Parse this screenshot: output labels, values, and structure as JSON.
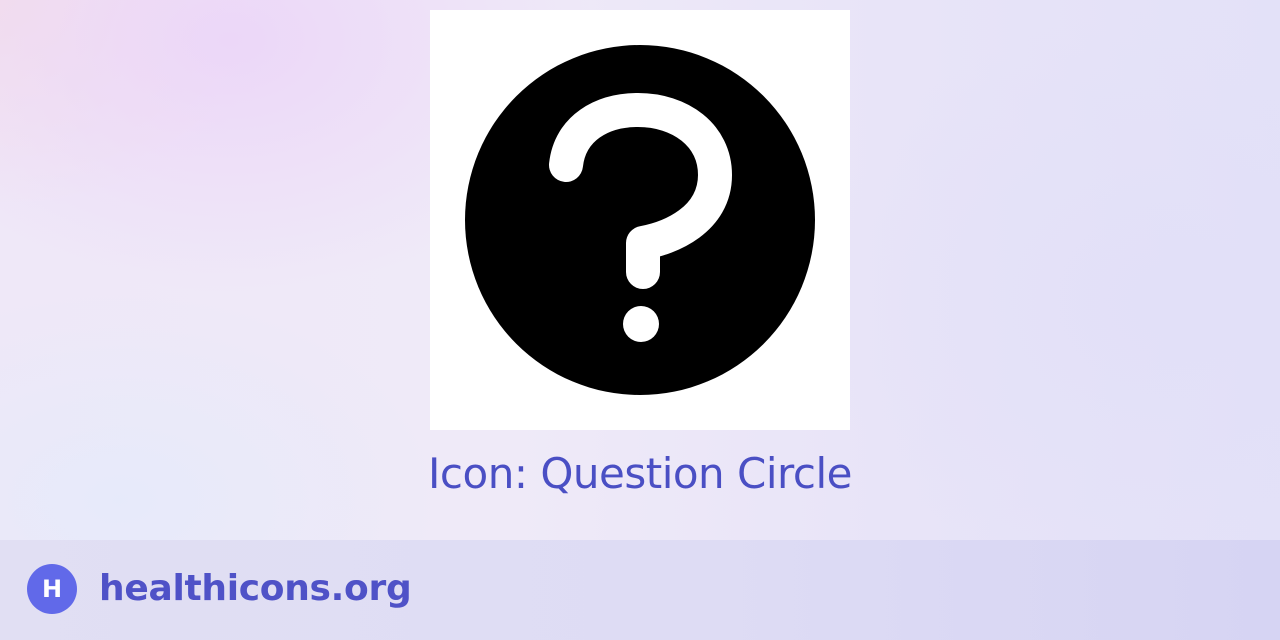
{
  "icon": {
    "name": "question-circle-icon",
    "caption": "Icon: Question Circle",
    "fill_color": "#000000",
    "glyph_color": "#ffffff",
    "tile_color": "#ffffff"
  },
  "footer": {
    "logo_letter": "H",
    "site_name": "healthicons.org",
    "brand_color": "#6169e9",
    "text_color": "#4f52c7"
  },
  "caption_color": "#4a4fc4"
}
